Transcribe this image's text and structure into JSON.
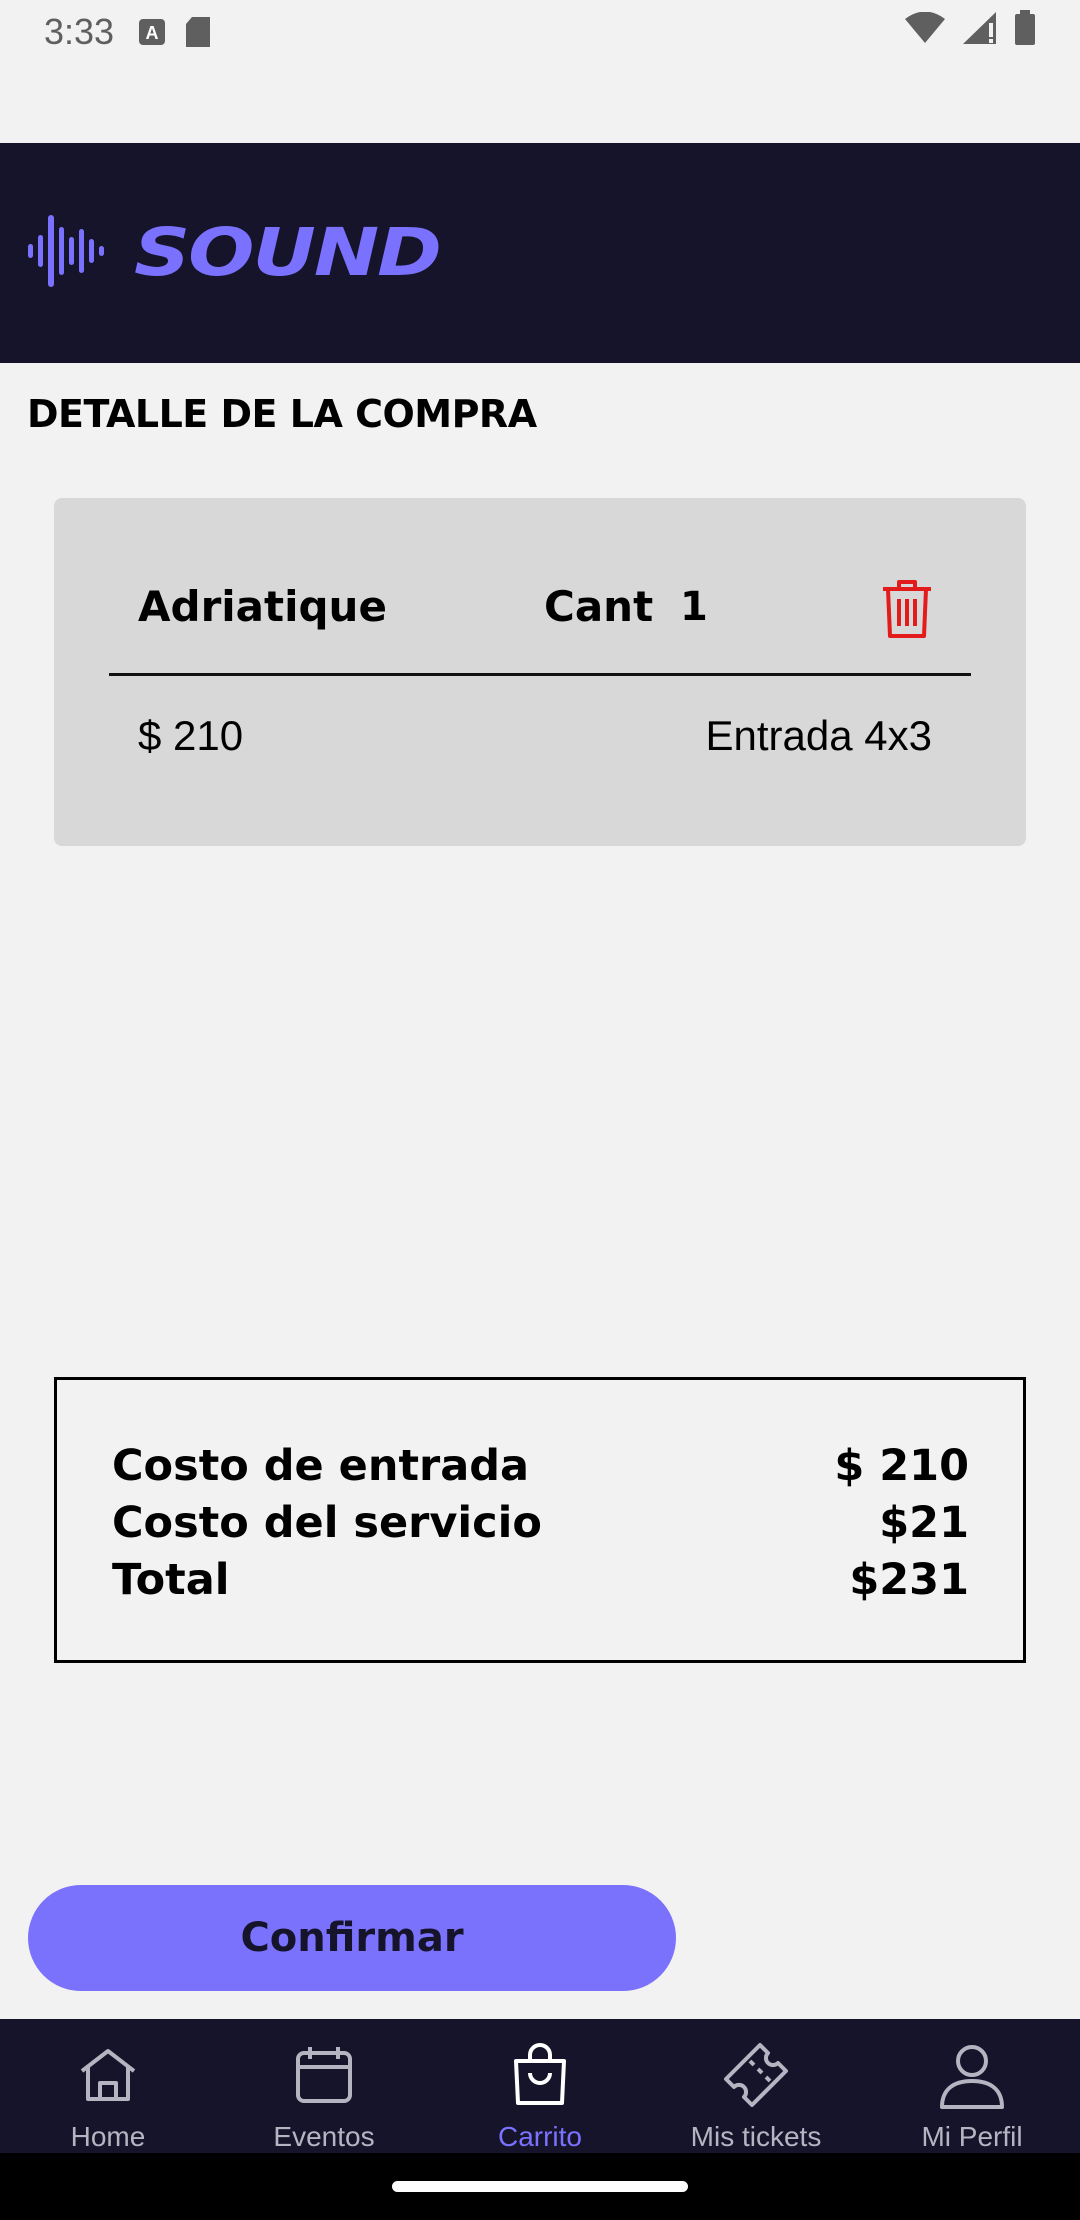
{
  "status_bar": {
    "time": "3:33"
  },
  "header": {
    "brand": "SOUND",
    "brand_color": "#7a72ff",
    "background": "#16142b"
  },
  "page": {
    "title": "DETALLE DE LA COMPRA"
  },
  "cart_item": {
    "name": "Adriatique",
    "qty_label": "Cant",
    "qty_value": "1",
    "price": "$ 210",
    "ticket_type": "Entrada 4x3",
    "delete_icon": "trash-icon",
    "delete_icon_color": "#e21b1b"
  },
  "summary": {
    "rows": [
      {
        "label": "Costo de entrada",
        "value": "$ 210"
      },
      {
        "label": "Costo del servicio",
        "value": "$21"
      },
      {
        "label": "Total",
        "value": "$231"
      }
    ]
  },
  "actions": {
    "confirm_label": "Confirmar",
    "accent": "#7a72fc"
  },
  "bottom_nav": {
    "items": [
      {
        "label": "Home",
        "icon": "home-icon",
        "active": false
      },
      {
        "label": "Eventos",
        "icon": "calendar-icon",
        "active": false
      },
      {
        "label": "Carrito",
        "icon": "shopping-bag-icon",
        "active": true
      },
      {
        "label": "Mis tickets",
        "icon": "ticket-icon",
        "active": false
      },
      {
        "label": "Mi Perfil",
        "icon": "user-icon",
        "active": false
      }
    ]
  }
}
